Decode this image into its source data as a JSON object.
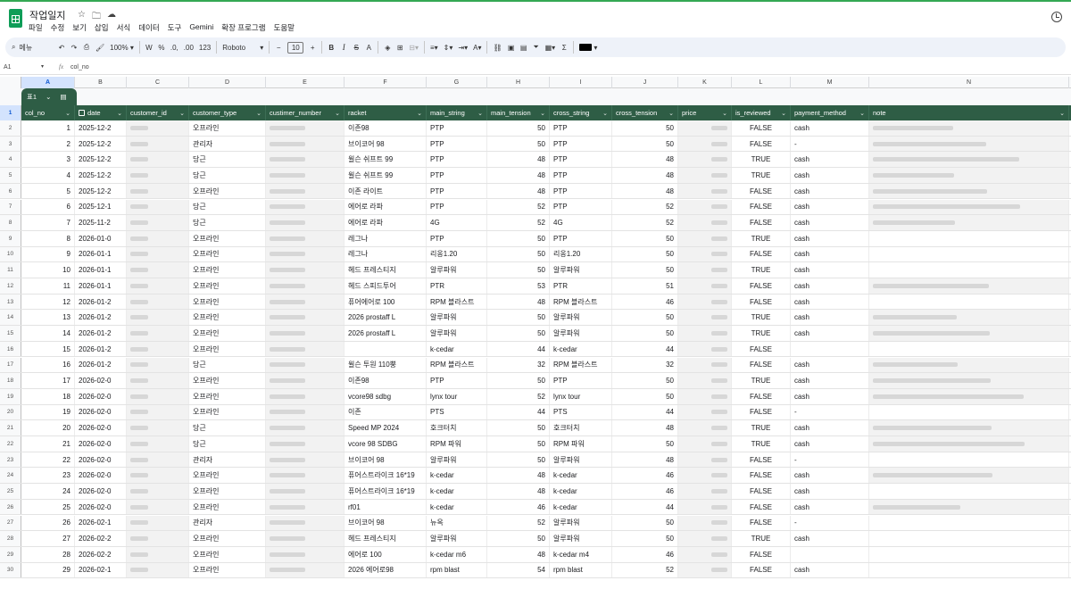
{
  "app": {
    "doc_title": "작업일지",
    "menu": [
      "파일",
      "수정",
      "보기",
      "삽입",
      "서식",
      "데이터",
      "도구",
      "Gemini",
      "확장 프로그램",
      "도움말"
    ]
  },
  "toolbar": {
    "search_label": "메뉴",
    "zoom": "100%",
    "currency": "W",
    "percent": "%",
    "dec_decrease": ".0,",
    ".00_label": ".00",
    "more_formats": "123",
    "font": "Roboto",
    "font_size": "10",
    "minus": "−",
    "plus": "+",
    "bold": "B",
    "italic": "I",
    "strike": "S",
    "text_color": "A",
    "sum": "Σ"
  },
  "formula": {
    "cell_ref": "A1",
    "fx": "fx",
    "value": "col_no"
  },
  "columns": [
    "A",
    "B",
    "C",
    "D",
    "E",
    "F",
    "G",
    "H",
    "I",
    "J",
    "K",
    "L",
    "M",
    "N"
  ],
  "table_chip": {
    "label": "표1"
  },
  "headers": [
    "col_no",
    "date",
    "customer_id",
    "customer_type",
    "custimer_number",
    "racket",
    "main_string",
    "main_tension",
    "cross_string",
    "cross_tension",
    "price",
    "is_reviewed",
    "payment_method",
    "note"
  ],
  "rows": [
    {
      "n": "2",
      "col_no": "1",
      "date": "2025-12-2",
      "type": "오프라인",
      "racket": "이존98",
      "ms": "PTP",
      "mt": "50",
      "cs": "PTP",
      "ct": "50",
      "rev": "FALSE",
      "pay": "cash",
      "note": true
    },
    {
      "n": "3",
      "col_no": "2",
      "date": "2025-12-2",
      "type": "관리자",
      "racket": "브이코어 98",
      "ms": "PTP",
      "mt": "50",
      "cs": "PTP",
      "ct": "50",
      "rev": "FALSE",
      "pay": "-",
      "note": true
    },
    {
      "n": "4",
      "col_no": "3",
      "date": "2025-12-2",
      "type": "당근",
      "racket": "윌슨 쉬프트 99",
      "ms": "PTP",
      "mt": "48",
      "cs": "PTP",
      "ct": "48",
      "rev": "TRUE",
      "pay": "cash",
      "note": true
    },
    {
      "n": "5",
      "col_no": "4",
      "date": "2025-12-2",
      "type": "당근",
      "racket": "윌슨 쉬프트 99",
      "ms": "PTP",
      "mt": "48",
      "cs": "PTP",
      "ct": "48",
      "rev": "TRUE",
      "pay": "cash",
      "note": true
    },
    {
      "n": "6",
      "col_no": "5",
      "date": "2025-12-2",
      "type": "오프라인",
      "racket": "이존 라이트",
      "ms": "PTP",
      "mt": "48",
      "cs": "PTP",
      "ct": "48",
      "rev": "FALSE",
      "pay": "cash",
      "note": true
    },
    {
      "n": "7",
      "col_no": "6",
      "date": "2025-12-1",
      "type": "당근",
      "racket": "에어로 라파",
      "ms": "PTP",
      "mt": "52",
      "cs": "PTP",
      "ct": "52",
      "rev": "FALSE",
      "pay": "cash",
      "note": true
    },
    {
      "n": "8",
      "col_no": "7",
      "date": "2025-11-2",
      "type": "당근",
      "racket": "에어로 라파",
      "ms": "4G",
      "mt": "52",
      "cs": "4G",
      "ct": "52",
      "rev": "FALSE",
      "pay": "cash",
      "note": true
    },
    {
      "n": "9",
      "col_no": "8",
      "date": "2026-01-0",
      "type": "오프라인",
      "racket": "레그나",
      "ms": "PTP",
      "mt": "50",
      "cs": "PTP",
      "ct": "50",
      "rev": "TRUE",
      "pay": "cash",
      "note": false
    },
    {
      "n": "10",
      "col_no": "9",
      "date": "2026-01-1",
      "type": "오프라인",
      "racket": "레그나",
      "ms": "리옹1.20",
      "mt": "50",
      "cs": "리옹1.20",
      "ct": "50",
      "rev": "FALSE",
      "pay": "cash",
      "note": false
    },
    {
      "n": "11",
      "col_no": "10",
      "date": "2026-01-1",
      "type": "오프라인",
      "racket": "헤드 프레스티지",
      "ms": "알루파워",
      "mt": "50",
      "cs": "알루파워",
      "ct": "50",
      "rev": "TRUE",
      "pay": "cash",
      "note": false
    },
    {
      "n": "12",
      "col_no": "11",
      "date": "2026-01-1",
      "type": "오프라인",
      "racket": "헤드 스피드투어",
      "ms": "PTR",
      "mt": "53",
      "cs": "PTR",
      "ct": "51",
      "rev": "FALSE",
      "pay": "cash",
      "note": true
    },
    {
      "n": "13",
      "col_no": "12",
      "date": "2026-01-2",
      "type": "오프라인",
      "racket": "퓨어에어로 100",
      "ms": "RPM 블라스트",
      "mt": "48",
      "cs": "RPM 블라스트",
      "ct": "46",
      "rev": "FALSE",
      "pay": "cash",
      "note": false
    },
    {
      "n": "14",
      "col_no": "13",
      "date": "2026-01-2",
      "type": "오프라인",
      "racket": "2026 prostaff L",
      "ms": "알루파워",
      "mt": "50",
      "cs": "알루파워",
      "ct": "50",
      "rev": "TRUE",
      "pay": "cash",
      "note": true
    },
    {
      "n": "15",
      "col_no": "14",
      "date": "2026-01-2",
      "type": "오프라인",
      "racket": "2026 prostaff L",
      "ms": "알루파워",
      "mt": "50",
      "cs": "알루파워",
      "ct": "50",
      "rev": "TRUE",
      "pay": "cash",
      "note": true
    },
    {
      "n": "16",
      "col_no": "15",
      "date": "2026-01-2",
      "type": "오프라인",
      "racket": "",
      "ms": "k-cedar",
      "mt": "44",
      "cs": "k-cedar",
      "ct": "44",
      "rev": "FALSE",
      "pay": "",
      "note": false
    },
    {
      "n": "17",
      "col_no": "16",
      "date": "2026-01-2",
      "type": "당근",
      "racket": "윌슨 투원 110뿡",
      "ms": "RPM 블라스트",
      "mt": "32",
      "cs": "RPM 블라스트",
      "ct": "32",
      "rev": "FALSE",
      "pay": "cash",
      "note": true
    },
    {
      "n": "18",
      "col_no": "17",
      "date": "2026-02-0",
      "type": "오프라인",
      "racket": "이존98",
      "ms": "PTP",
      "mt": "50",
      "cs": "PTP",
      "ct": "50",
      "rev": "TRUE",
      "pay": "cash",
      "note": true
    },
    {
      "n": "19",
      "col_no": "18",
      "date": "2026-02-0",
      "type": "오프라인",
      "racket": "vcore98 sdbg",
      "ms": "lynx tour",
      "mt": "52",
      "cs": "lynx tour",
      "ct": "50",
      "rev": "FALSE",
      "pay": "cash",
      "note": true
    },
    {
      "n": "20",
      "col_no": "19",
      "date": "2026-02-0",
      "type": "오프라인",
      "racket": "이존",
      "ms": "PTS",
      "mt": "44",
      "cs": "PTS",
      "ct": "44",
      "rev": "FALSE",
      "pay": "-",
      "note": false
    },
    {
      "n": "21",
      "col_no": "20",
      "date": "2026-02-0",
      "type": "당근",
      "racket": "Speed MP 2024",
      "ms": "호크터치",
      "mt": "50",
      "cs": "호크터치",
      "ct": "48",
      "rev": "TRUE",
      "pay": "cash",
      "note": true
    },
    {
      "n": "22",
      "col_no": "21",
      "date": "2026-02-0",
      "type": "당근",
      "racket": "vcore 98 SDBG",
      "ms": "RPM 파워",
      "mt": "50",
      "cs": "RPM 파워",
      "ct": "50",
      "rev": "TRUE",
      "pay": "cash",
      "note": true
    },
    {
      "n": "23",
      "col_no": "22",
      "date": "2026-02-0",
      "type": "관리자",
      "racket": "브이코어 98",
      "ms": "알루파워",
      "mt": "50",
      "cs": "알루파워",
      "ct": "48",
      "rev": "FALSE",
      "pay": "-",
      "note": false
    },
    {
      "n": "24",
      "col_no": "23",
      "date": "2026-02-0",
      "type": "오프라인",
      "racket": "퓨어스트라이크 16*19",
      "ms": "k-cedar",
      "mt": "48",
      "cs": "k-cedar",
      "ct": "46",
      "rev": "FALSE",
      "pay": "cash",
      "note": true
    },
    {
      "n": "25",
      "col_no": "24",
      "date": "2026-02-0",
      "type": "오프라인",
      "racket": "퓨어스트라이크 16*19",
      "ms": "k-cedar",
      "mt": "48",
      "cs": "k-cedar",
      "ct": "46",
      "rev": "FALSE",
      "pay": "cash",
      "note": false
    },
    {
      "n": "26",
      "col_no": "25",
      "date": "2026-02-0",
      "type": "오프라인",
      "racket": "rf01",
      "ms": "k-cedar",
      "mt": "46",
      "cs": "k-cedar",
      "ct": "44",
      "rev": "FALSE",
      "pay": "cash",
      "note": true
    },
    {
      "n": "27",
      "col_no": "26",
      "date": "2026-02-1",
      "type": "관리자",
      "racket": "브이코어 98",
      "ms": "뉴옥",
      "mt": "52",
      "cs": "알루파워",
      "ct": "50",
      "rev": "FALSE",
      "pay": "-",
      "note": false
    },
    {
      "n": "28",
      "col_no": "27",
      "date": "2026-02-2",
      "type": "오프라인",
      "racket": "헤드 프레스티지",
      "ms": "알루파워",
      "mt": "50",
      "cs": "알루파워",
      "ct": "50",
      "rev": "TRUE",
      "pay": "cash",
      "note": false
    },
    {
      "n": "29",
      "col_no": "28",
      "date": "2026-02-2",
      "type": "오프라인",
      "racket": "에어로 100",
      "ms": "k-cedar m6",
      "mt": "48",
      "cs": "k-cedar m4",
      "ct": "46",
      "rev": "FALSE",
      "pay": "",
      "note": false
    },
    {
      "n": "30",
      "col_no": "29",
      "date": "2026-02-1",
      "type": "오프라인",
      "racket": "2026 에어로98",
      "ms": "rpm blast",
      "mt": "54",
      "cs": "rpm blast",
      "ct": "52",
      "rev": "FALSE",
      "pay": "cash",
      "note": false
    }
  ]
}
